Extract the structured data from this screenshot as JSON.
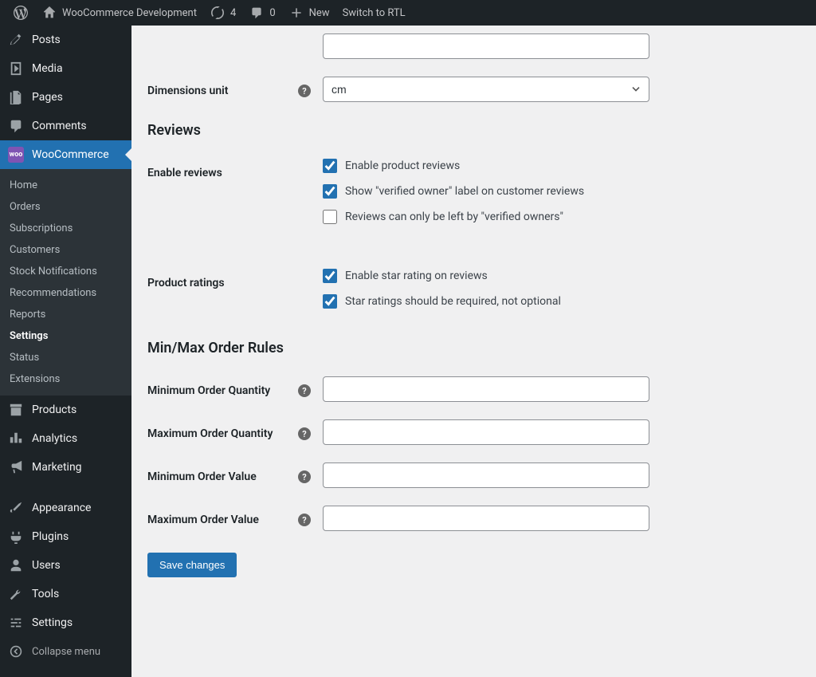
{
  "adminbar": {
    "site_name": "WooCommerce Development",
    "updates_count": "4",
    "comments_count": "0",
    "new_label": "New",
    "rtl_label": "Switch to RTL"
  },
  "sidebar": {
    "posts": "Posts",
    "media": "Media",
    "pages": "Pages",
    "comments": "Comments",
    "woocommerce": "WooCommerce",
    "submenu": {
      "home": "Home",
      "orders": "Orders",
      "subscriptions": "Subscriptions",
      "customers": "Customers",
      "stock_notifications": "Stock Notifications",
      "recommendations": "Recommendations",
      "reports": "Reports",
      "settings": "Settings",
      "status": "Status",
      "extensions": "Extensions"
    },
    "products": "Products",
    "analytics": "Analytics",
    "marketing": "Marketing",
    "appearance": "Appearance",
    "plugins": "Plugins",
    "users": "Users",
    "tools": "Tools",
    "settings": "Settings",
    "collapse": "Collapse menu"
  },
  "form": {
    "dimensions_label": "Dimensions unit",
    "dimensions_value": "cm",
    "reviews_heading": "Reviews",
    "enable_reviews_label": "Enable reviews",
    "enable_product_reviews": "Enable product reviews",
    "show_verified_owner": "Show \"verified owner\" label on customer reviews",
    "only_verified_owners": "Reviews can only be left by \"verified owners\"",
    "product_ratings_label": "Product ratings",
    "enable_star_rating": "Enable star rating on reviews",
    "star_required": "Star ratings should be required, not optional",
    "minmax_heading": "Min/Max Order Rules",
    "min_qty_label": "Minimum Order Quantity",
    "max_qty_label": "Maximum Order Quantity",
    "min_val_label": "Minimum Order Value",
    "max_val_label": "Maximum Order Value",
    "save_label": "Save changes"
  }
}
